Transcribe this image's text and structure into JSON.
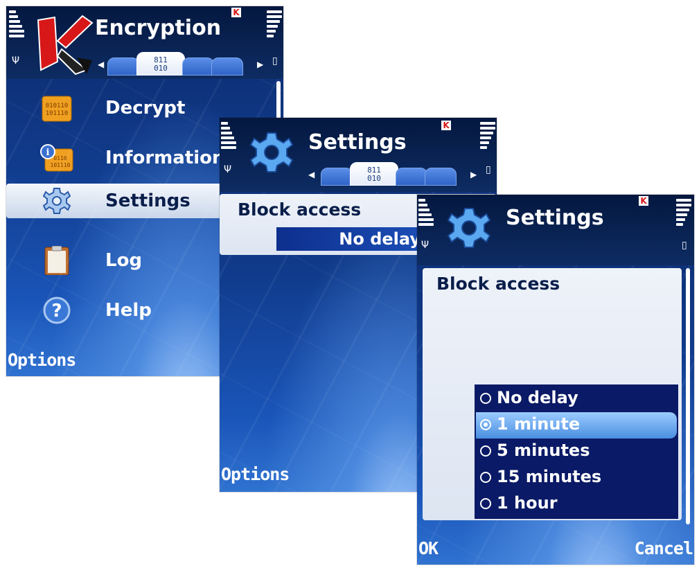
{
  "screen1": {
    "title": "Encryption",
    "tab_active_text": "811\n010",
    "menu": [
      {
        "label": "Decrypt",
        "icon": "binary-folder-icon"
      },
      {
        "label": "Information",
        "icon": "info-folder-icon"
      },
      {
        "label": "Settings",
        "icon": "gear-icon"
      },
      {
        "label": "Log",
        "icon": "clipboard-icon"
      },
      {
        "label": "Help",
        "icon": "help-icon"
      }
    ],
    "selected_index": 2,
    "left_softkey": "Options"
  },
  "screen2": {
    "title": "Settings",
    "tab_active_text": "811\n010",
    "setting_label": "Block access",
    "setting_value": "No delay",
    "left_softkey": "Options"
  },
  "screen3": {
    "title": "Settings",
    "setting_label": "Block access",
    "options": [
      "No delay",
      "1 minute",
      "5 minutes",
      "15 minutes",
      "1 hour"
    ],
    "selected_index": 1,
    "left_softkey": "OK",
    "right_softkey": "Cancel"
  },
  "colors": {
    "header": "#0a2455",
    "highlight": "#4a8fe0",
    "list_bg": "#0a1a66",
    "kaspersky_red": "#d81818"
  }
}
